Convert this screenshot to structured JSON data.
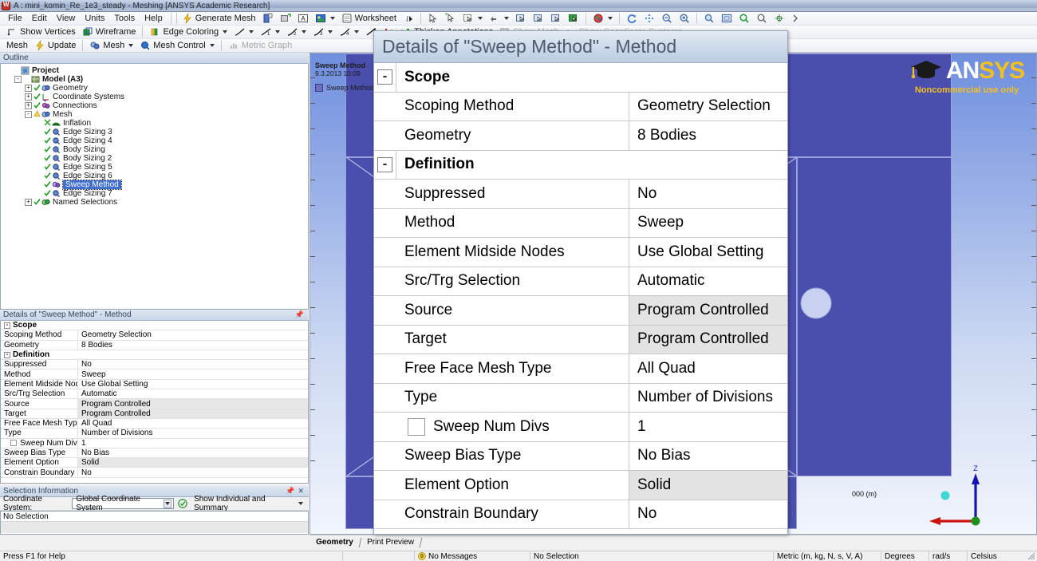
{
  "window": {
    "title": "A : mini_komin_Re_1e3_steady - Meshing [ANSYS Academic Research]",
    "app_icon": "workbench-icon"
  },
  "menubar": {
    "items": [
      "File",
      "Edit",
      "View",
      "Units",
      "Tools",
      "Help"
    ]
  },
  "toolbar1": {
    "generate_mesh": "Generate Mesh",
    "worksheet": "Worksheet",
    "icons": [
      "generate-mesh-icon",
      "new-section-plane-icon",
      "named-selection-icon",
      "annotation-icon",
      "image-icon",
      "worksheet-icon",
      "selection-info-icon",
      "cursor-icon",
      "probe-icon",
      "probe-alt-icon",
      "view-icon",
      "set-icon",
      "set2-icon",
      "set3-icon",
      "set4-icon",
      "color-icon",
      "refresh-icon",
      "pan-icon",
      "zoom-out-icon",
      "zoom-in-icon",
      "box-zoom-icon",
      "fit-icon",
      "magnifier-icon",
      "search-icon",
      "wireframe-toggle-icon"
    ]
  },
  "toolbar2": {
    "show_vertices": "Show Vertices",
    "wireframe": "Wireframe",
    "edge_coloring": "Edge Coloring",
    "thicken_annotations": "Thicken Annotations",
    "show_mesh": "Show Mesh",
    "show_coordinate_systems": "Show Coordinate Systems"
  },
  "toolbar3": {
    "mesh": "Mesh",
    "update": "Update",
    "mesh_menu": "Mesh",
    "mesh_control": "Mesh Control",
    "metric_graph": "Metric Graph"
  },
  "outline": {
    "title": "Outline",
    "items": [
      {
        "label": "Project",
        "depth": 0,
        "toggle": "",
        "icon": "project-icon",
        "bold": true,
        "selected": false,
        "check": ""
      },
      {
        "label": "Model (A3)",
        "depth": 1,
        "toggle": "-",
        "icon": "model-icon",
        "bold": true,
        "selected": false,
        "check": ""
      },
      {
        "label": "Geometry",
        "depth": 2,
        "toggle": "+",
        "icon": "geometry-icon",
        "bold": false,
        "selected": false,
        "check": "ok"
      },
      {
        "label": "Coordinate Systems",
        "depth": 2,
        "toggle": "+",
        "icon": "coordsys-icon",
        "bold": false,
        "selected": false,
        "check": "ok"
      },
      {
        "label": "Connections",
        "depth": 2,
        "toggle": "+",
        "icon": "connections-icon",
        "bold": false,
        "selected": false,
        "check": "ok"
      },
      {
        "label": "Mesh",
        "depth": 2,
        "toggle": "-",
        "icon": "mesh-icon",
        "bold": false,
        "selected": false,
        "check": "warn"
      },
      {
        "label": "Inflation",
        "depth": 3,
        "toggle": "",
        "icon": "inflation-icon",
        "bold": false,
        "selected": false,
        "check": "x"
      },
      {
        "label": "Edge Sizing 3",
        "depth": 3,
        "toggle": "",
        "icon": "sizing-icon",
        "bold": false,
        "selected": false,
        "check": "ok"
      },
      {
        "label": "Edge Sizing 4",
        "depth": 3,
        "toggle": "",
        "icon": "sizing-icon",
        "bold": false,
        "selected": false,
        "check": "ok"
      },
      {
        "label": "Body Sizing",
        "depth": 3,
        "toggle": "",
        "icon": "sizing-icon",
        "bold": false,
        "selected": false,
        "check": "ok"
      },
      {
        "label": "Body Sizing 2",
        "depth": 3,
        "toggle": "",
        "icon": "sizing-icon",
        "bold": false,
        "selected": false,
        "check": "ok"
      },
      {
        "label": "Edge Sizing 5",
        "depth": 3,
        "toggle": "",
        "icon": "sizing-icon",
        "bold": false,
        "selected": false,
        "check": "ok"
      },
      {
        "label": "Edge Sizing 6",
        "depth": 3,
        "toggle": "",
        "icon": "sizing-icon",
        "bold": false,
        "selected": false,
        "check": "ok"
      },
      {
        "label": "Sweep Method",
        "depth": 3,
        "toggle": "",
        "icon": "method-icon",
        "bold": false,
        "selected": true,
        "check": "ok"
      },
      {
        "label": "Edge Sizing 7",
        "depth": 3,
        "toggle": "",
        "icon": "sizing-icon",
        "bold": false,
        "selected": false,
        "check": "ok"
      },
      {
        "label": "Named Selections",
        "depth": 2,
        "toggle": "+",
        "icon": "named-sel-icon",
        "bold": false,
        "selected": false,
        "check": "ok"
      }
    ]
  },
  "details": {
    "title": "Details of \"Sweep Method\" - Method",
    "pin_icon": "pin-icon",
    "rows": [
      {
        "type": "section",
        "toggle": "-",
        "key": "Scope",
        "value": ""
      },
      {
        "type": "row",
        "key": "Scoping Method",
        "value": "Geometry Selection",
        "shaded": false
      },
      {
        "type": "row",
        "key": "Geometry",
        "value": "8 Bodies",
        "shaded": false
      },
      {
        "type": "section",
        "toggle": "-",
        "key": "Definition",
        "value": ""
      },
      {
        "type": "row",
        "key": "Suppressed",
        "value": "No",
        "shaded": false
      },
      {
        "type": "row",
        "key": "Method",
        "value": "Sweep",
        "shaded": false
      },
      {
        "type": "row",
        "key": "Element Midside Nodes",
        "value": "Use Global Setting",
        "shaded": false
      },
      {
        "type": "row",
        "key": "Src/Trg Selection",
        "value": "Automatic",
        "shaded": false
      },
      {
        "type": "row",
        "key": "Source",
        "value": "Program Controlled",
        "shaded": true
      },
      {
        "type": "row",
        "key": "Target",
        "value": "Program Controlled",
        "shaded": true
      },
      {
        "type": "row",
        "key": "Free Face Mesh Type",
        "value": "All Quad",
        "shaded": false
      },
      {
        "type": "row",
        "key": "Type",
        "value": "Number of Divisions",
        "shaded": false
      },
      {
        "type": "checkrow",
        "key": "Sweep Num Divs",
        "value": "1",
        "shaded": false
      },
      {
        "type": "row",
        "key": "Sweep Bias Type",
        "value": "No Bias",
        "shaded": false
      },
      {
        "type": "row",
        "key": "Element Option",
        "value": "Solid",
        "shaded": true
      },
      {
        "type": "row",
        "key": "Constrain Boundary",
        "value": "No",
        "shaded": false
      }
    ]
  },
  "selection_information": {
    "title": "Selection Information",
    "pin_icon": "pin-icon",
    "close_icon": "close-icon",
    "coordinate_system_label": "Coordinate System:",
    "coordinate_system_value": "Global Coordinate System",
    "validate_icon": "validate-icon",
    "show_mode": "Show Individual and Summary",
    "body_text": "No Selection"
  },
  "viewport": {
    "annotation_title": "Sweep Method",
    "annotation_date": "9.3.2013 10:09",
    "legend_label": "Sweep Method",
    "scale_label": "000 (m)",
    "logo": {
      "an": "AN",
      "sys": "SYS",
      "notice": "Noncommercial use only",
      "cap_icon": "graduation-cap-icon"
    },
    "triad": {
      "z_label": "Z",
      "x_axis_color": "#cc1111",
      "z_axis_color": "#1414b4",
      "origin_color": "#1f8f1f",
      "sphere_color": "#3fd6d6"
    },
    "tabs": [
      {
        "label": "Geometry",
        "active": true
      },
      {
        "label": "Print Preview",
        "active": false
      }
    ]
  },
  "statusbar": {
    "help": "Press F1 for Help",
    "messages": "No Messages",
    "messages_count": "0",
    "selection": "No Selection",
    "units": "Metric (m, kg, N, s, V, A)",
    "angle": "Degrees",
    "rotational": "rad/s",
    "temperature": "Celsius"
  },
  "zoom_dialog": {
    "title": "Details of \"Sweep Method\" - Method",
    "rows": [
      {
        "type": "section",
        "toggle": "-",
        "key": "Scope",
        "value": ""
      },
      {
        "type": "row",
        "key": "Scoping Method",
        "value": "Geometry Selection",
        "shaded": false
      },
      {
        "type": "row",
        "key": "Geometry",
        "value": "8 Bodies",
        "shaded": false
      },
      {
        "type": "section",
        "toggle": "-",
        "key": "Definition",
        "value": ""
      },
      {
        "type": "row",
        "key": "Suppressed",
        "value": "No",
        "shaded": false
      },
      {
        "type": "row",
        "key": "Method",
        "value": "Sweep",
        "shaded": false
      },
      {
        "type": "row",
        "key": "Element Midside Nodes",
        "value": "Use Global Setting",
        "shaded": false
      },
      {
        "type": "row",
        "key": "Src/Trg Selection",
        "value": "Automatic",
        "shaded": false
      },
      {
        "type": "row",
        "key": "Source",
        "value": "Program Controlled",
        "shaded": true
      },
      {
        "type": "row",
        "key": "Target",
        "value": "Program Controlled",
        "shaded": true
      },
      {
        "type": "row",
        "key": "Free Face Mesh Type",
        "value": "All Quad",
        "shaded": false
      },
      {
        "type": "row",
        "key": "Type",
        "value": "Number of Divisions",
        "shaded": false
      },
      {
        "type": "checkrow",
        "key": "Sweep Num Divs",
        "value": "1",
        "shaded": false
      },
      {
        "type": "row",
        "key": "Sweep Bias Type",
        "value": "No Bias",
        "shaded": false
      },
      {
        "type": "row",
        "key": "Element Option",
        "value": "Solid",
        "shaded": true
      },
      {
        "type": "row",
        "key": "Constrain Boundary",
        "value": "No",
        "shaded": false
      }
    ]
  }
}
